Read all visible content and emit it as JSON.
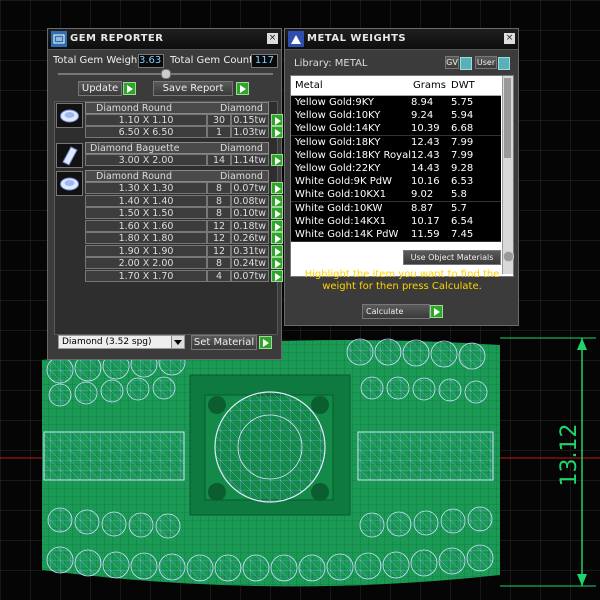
{
  "gem_reporter": {
    "title": "GEM REPORTER",
    "total_weight_label": "Total Gem Weight",
    "total_weight_value": "3.63",
    "total_count_label": "Total Gem Count",
    "total_count_value": "117",
    "update_label": "Update",
    "save_report_label": "Save Report",
    "groups": [
      {
        "name": "Diamond Round",
        "material": "Diamond",
        "icon": "round-gem-icon",
        "rows": [
          {
            "size": "1.10 X 1.10",
            "count": "30",
            "weight": "0.15tw"
          },
          {
            "size": "6.50 X 6.50",
            "count": "1",
            "weight": "1.03tw"
          }
        ]
      },
      {
        "name": "Diamond Baguette",
        "material": "Diamond",
        "icon": "baguette-gem-icon",
        "rows": [
          {
            "size": "3.00 X 2.00",
            "count": "14",
            "weight": "1.14tw"
          }
        ]
      },
      {
        "name": "Diamond Round",
        "material": "Diamond",
        "icon": "round-gem-icon",
        "rows": [
          {
            "size": "1.30 X 1.30",
            "count": "8",
            "weight": "0.07tw"
          },
          {
            "size": "1.40 X 1.40",
            "count": "8",
            "weight": "0.08tw"
          },
          {
            "size": "1.50 X 1.50",
            "count": "8",
            "weight": "0.10tw"
          },
          {
            "size": "1.60 X 1.60",
            "count": "12",
            "weight": "0.18tw"
          },
          {
            "size": "1.80 X 1.80",
            "count": "12",
            "weight": "0.26tw"
          },
          {
            "size": "1.90 X 1.90",
            "count": "12",
            "weight": "0.31tw"
          },
          {
            "size": "2.00 X 2.00",
            "count": "8",
            "weight": "0.24tw"
          },
          {
            "size": "1.70 X 1.70",
            "count": "4",
            "weight": "0.07tw"
          }
        ]
      }
    ],
    "material_select": "Diamond    (3.52 spg)",
    "set_material_label": "Set Material"
  },
  "metal_weights": {
    "title": "METAL WEIGHTS",
    "library_label": "Library: METAL",
    "toggle_gv": "GV",
    "toggle_user": "User",
    "columns": [
      "Metal",
      "Grams",
      "DWT"
    ],
    "rows": [
      {
        "metal": "Yellow Gold:9KY",
        "grams": "8.94",
        "dwt": "5.75"
      },
      {
        "metal": "Yellow Gold:10KY",
        "grams": "9.24",
        "dwt": "5.94"
      },
      {
        "metal": "Yellow Gold:14KY",
        "grams": "10.39",
        "dwt": "6.68"
      },
      {
        "metal": "Yellow Gold:18KY",
        "grams": "12.43",
        "dwt": "7.99"
      },
      {
        "metal": "Yellow Gold:18KY Royal",
        "grams": "12.43",
        "dwt": "7.99"
      },
      {
        "metal": "Yellow Gold:22KY",
        "grams": "14.43",
        "dwt": "9.28"
      },
      {
        "metal": "White Gold:9K PdW",
        "grams": "10.16",
        "dwt": "6.53"
      },
      {
        "metal": "White Gold:10KX1",
        "grams": "9.02",
        "dwt": "5.8"
      },
      {
        "metal": "White Gold:10KW",
        "grams": "8.87",
        "dwt": "5.7"
      },
      {
        "metal": "White Gold:14KX1",
        "grams": "10.17",
        "dwt": "6.54"
      },
      {
        "metal": "White Gold:14K PdW",
        "grams": "11.59",
        "dwt": "7.45"
      }
    ],
    "use_object_materials_label": "Use Object Materials",
    "hint": "Highlight the item you want to find the weight for then press Calculate.",
    "calculate_label": "Calculate"
  },
  "viewport": {
    "dimension_value": "13.12",
    "dimension_color": "#1fd46a",
    "metal_color": "#1a9a55",
    "stone_color": "#8fb8ff",
    "axis_color": "#c01818"
  }
}
